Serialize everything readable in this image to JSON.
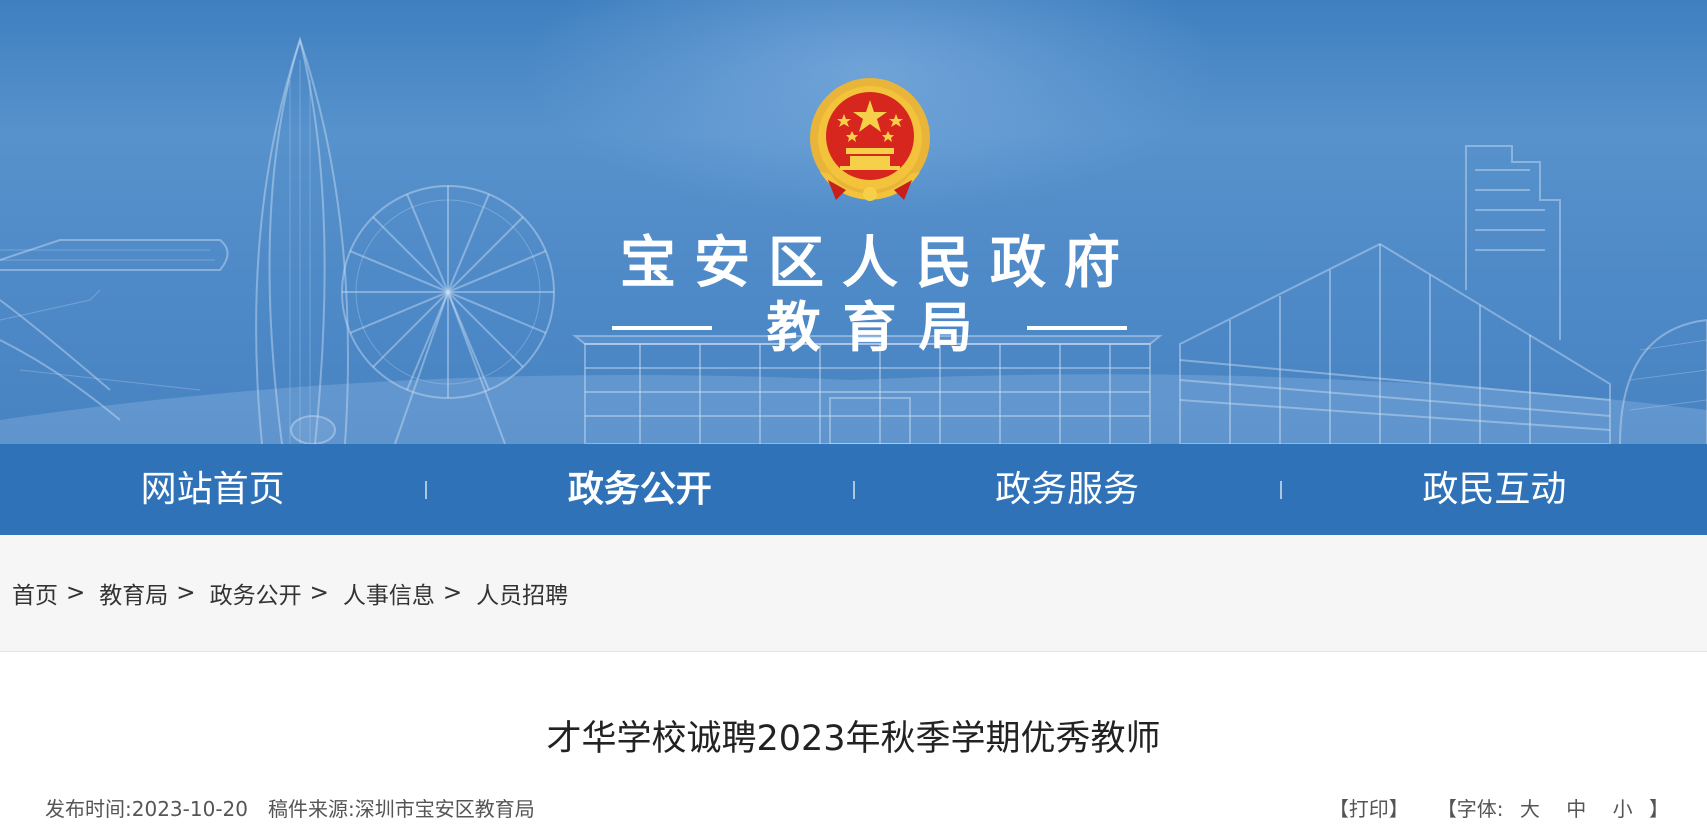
{
  "header": {
    "site_name": "宝安区人民政府",
    "department": "教育局"
  },
  "nav": {
    "items": [
      {
        "label": "网站首页"
      },
      {
        "label": "政务公开"
      },
      {
        "label": "政务服务"
      },
      {
        "label": "政民互动"
      }
    ],
    "active_index": 1
  },
  "breadcrumb": {
    "items": [
      {
        "label": "首页"
      },
      {
        "label": "教育局"
      },
      {
        "label": "政务公开"
      },
      {
        "label": "人事信息"
      },
      {
        "label": "人员招聘"
      }
    ],
    "separator": ">"
  },
  "article": {
    "title": "才华学校诚聘2023年秋季学期优秀教师",
    "publish_label": "发布时间:",
    "publish_date": "2023-10-20",
    "source_label": "稿件来源:",
    "source": "深圳市宝安区教育局",
    "print_label": "【打印】",
    "font_label_open": "【字体:",
    "font_large": "大",
    "font_medium": "中",
    "font_small": "小",
    "font_label_close": "】"
  },
  "colors": {
    "banner_blue": "#4d88c7",
    "nav_blue": "#2f72b8",
    "breadcrumb_bg": "#f6f6f6",
    "emblem_red": "#d7261e",
    "emblem_gold": "#f2c33b"
  },
  "icons": [
    "national-emblem-icon"
  ]
}
